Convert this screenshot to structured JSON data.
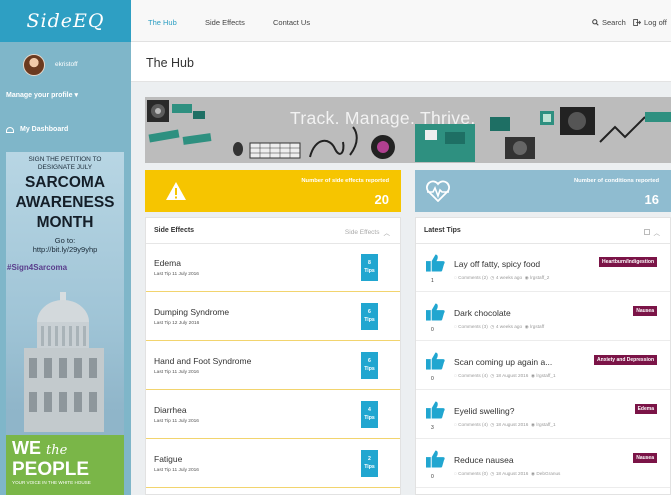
{
  "app": {
    "logo": "SideEQ"
  },
  "sidebar": {
    "username": "ekristoff",
    "manage_profile": "Manage your profile",
    "dashboard": "My Dashboard"
  },
  "ad": {
    "petition": "SIGN THE PETITION TO DESIGNATE JULY",
    "line1": "SARCOMA",
    "line2": "AWARENESS",
    "line3": "MONTH",
    "goto": "Go to:",
    "url": "http://bit.ly/29y9yhp",
    "hashtag": "#Sign4Sarcoma",
    "we": "WE",
    "the": "the",
    "people": "PEOPLE",
    "whitehouse": "YOUR VOICE IN THE WHITE HOUSE"
  },
  "nav": {
    "items": [
      "The Hub",
      "Side Effects",
      "Contact Us"
    ],
    "search": "Search",
    "logoff": "Log off"
  },
  "page": {
    "title": "The Hub"
  },
  "banner": {
    "tagline": "Track. Manage. Thrive."
  },
  "stats": {
    "side_effects_label": "Number of side effects reported",
    "side_effects_count": "20",
    "conditions_label": "Number of conditions reported",
    "conditions_count": "16"
  },
  "side_effects_panel": {
    "title": "Side Effects",
    "filter": "Side Effects",
    "rows": [
      {
        "name": "Edema",
        "last": "Last Tip 11 July 2016",
        "count": "8",
        "unit": "Tips"
      },
      {
        "name": "Dumping Syndrome",
        "last": "Last Tip 12 July 2016",
        "count": "6",
        "unit": "Tips"
      },
      {
        "name": "Hand and Foot Syndrome",
        "last": "Last Tip 11 July 2016",
        "count": "6",
        "unit": "Tips"
      },
      {
        "name": "Diarrhea",
        "last": "Last Tip 11 July 2016",
        "count": "4",
        "unit": "Tips"
      },
      {
        "name": "Fatigue",
        "last": "Last Tip 11 July 2016",
        "count": "2",
        "unit": "Tips"
      }
    ]
  },
  "tips_panel": {
    "title": "Latest Tips",
    "rows": [
      {
        "title": "Lay off fatty, spicy food",
        "votes": "1",
        "comments": "Comments (2)",
        "time": "4 weeks ago",
        "author": "lrgstaff_2",
        "tag": "Heartburn/Indigestion"
      },
      {
        "title": "Dark chocolate",
        "votes": "0",
        "comments": "Comments (3)",
        "time": "4 weeks ago",
        "author": "lrgstaff",
        "tag": "Nausea"
      },
      {
        "title": "Scan coming up again a...",
        "votes": "0",
        "comments": "Comments (4)",
        "time": "18 August 2016",
        "author": "lrgstaff_1",
        "tag": "Anxiety and Depression"
      },
      {
        "title": "Eyelid swelling?",
        "votes": "3",
        "comments": "Comments (4)",
        "time": "18 August 2016",
        "author": "lrgstaff_1",
        "tag": "Edema"
      },
      {
        "title": "Reduce nausea",
        "votes": "0",
        "comments": "Comments (0)",
        "time": "18 August 2016",
        "author": "DebGranus",
        "tag": "Nausea"
      }
    ]
  },
  "colors": {
    "accent": "#2e9fc3",
    "yellow": "#f6c500",
    "tag": "#7b1447"
  }
}
